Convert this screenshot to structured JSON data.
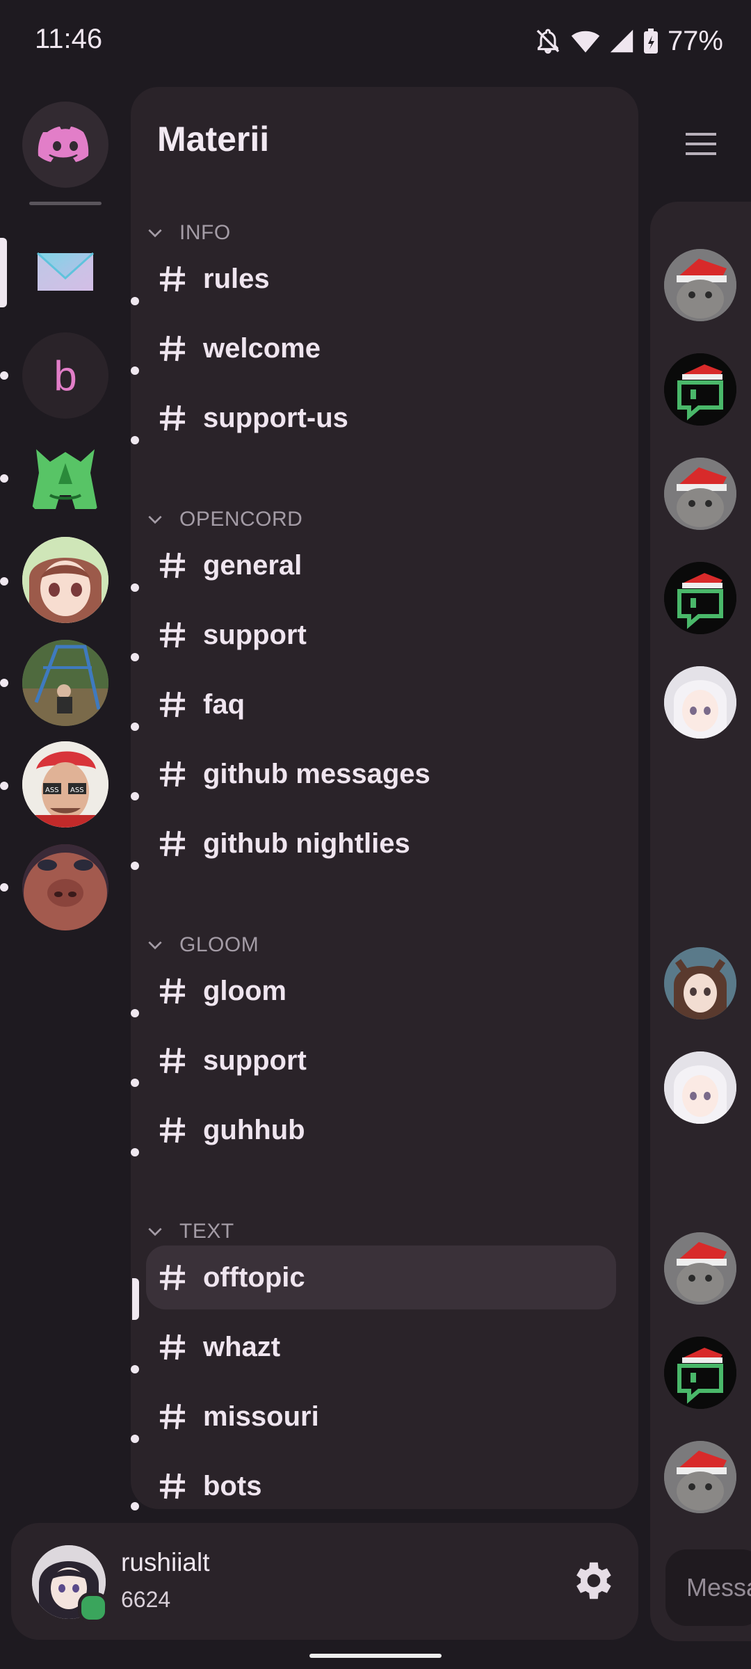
{
  "status_bar": {
    "time": "11:46",
    "battery": "77%"
  },
  "server": {
    "name": "Materii"
  },
  "server_rail": {
    "items": [
      {
        "name": "discord-home",
        "color": "#e27ec8"
      },
      {
        "name": "mail-server"
      },
      {
        "name": "b-server",
        "letter": "b"
      },
      {
        "name": "green-a-server"
      },
      {
        "name": "anime-girl-server"
      },
      {
        "name": "playground-server"
      },
      {
        "name": "red-hair-man-server"
      },
      {
        "name": "face-server"
      }
    ]
  },
  "categories": [
    {
      "label": "INFO",
      "channels": [
        "rules",
        "welcome",
        "support-us"
      ]
    },
    {
      "label": "OPENCORD",
      "channels": [
        "general",
        "support",
        "faq",
        "github messages",
        "github nightlies"
      ]
    },
    {
      "label": "GLOOM",
      "channels": [
        "gloom",
        "support",
        "guhhub"
      ]
    },
    {
      "label": "TEXT",
      "channels": [
        "offtopic",
        "whazt",
        "missouri",
        "bots"
      ]
    }
  ],
  "active_channel": "offtopic",
  "user": {
    "username": "rushiialt",
    "discriminator": "6624",
    "status": "online"
  },
  "message_placeholder": "Messa",
  "colors": {
    "accent": "#e27ec8",
    "online": "#3aa55c",
    "panel": "#2a2329",
    "background": "#1e1a20"
  }
}
